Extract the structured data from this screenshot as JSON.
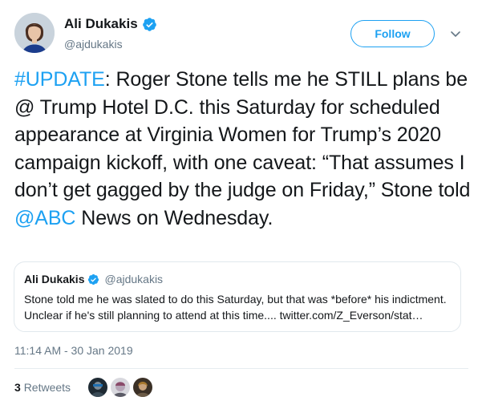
{
  "author": {
    "display_name": "Ali Dukakis",
    "handle": "@ajdukakis",
    "verified": true,
    "avatar_icon": "author-avatar"
  },
  "follow_button": {
    "label": "Follow"
  },
  "menu_icon": "chevron-down-icon",
  "tweet": {
    "segments": [
      {
        "text": "#UPDATE",
        "type": "hashtag"
      },
      {
        "text": ": Roger Stone tells me he STILL plans be @ Trump Hotel D.C. this Saturday for scheduled appearance at Virginia Women for Trump’s 2020 campaign kickoff, with one caveat: “That assumes I don’t get gagged by the judge on Friday,” Stone told ",
        "type": "text"
      },
      {
        "text": "@ABC",
        "type": "mention"
      },
      {
        "text": " News on Wednesday.",
        "type": "text"
      }
    ]
  },
  "quoted_tweet": {
    "display_name": "Ali Dukakis",
    "handle": "@ajdukakis",
    "verified": true,
    "text": "Stone told me he was slated to do this Saturday, but that was *before* his indictment. Unclear if he's still planning to attend at this time.... twitter.com/Z_Everson/stat…"
  },
  "timestamp": "11:14 AM - 30 Jan 2019",
  "stats": {
    "retweet_count": "3",
    "retweet_label": "Retweets"
  },
  "retweeter_avatars": [
    "retweeter-avatar-1",
    "retweeter-avatar-2",
    "retweeter-avatar-3"
  ],
  "colors": {
    "link": "#1da1f2",
    "text": "#14171a",
    "secondary": "#657786",
    "border": "#e1e8ed"
  }
}
